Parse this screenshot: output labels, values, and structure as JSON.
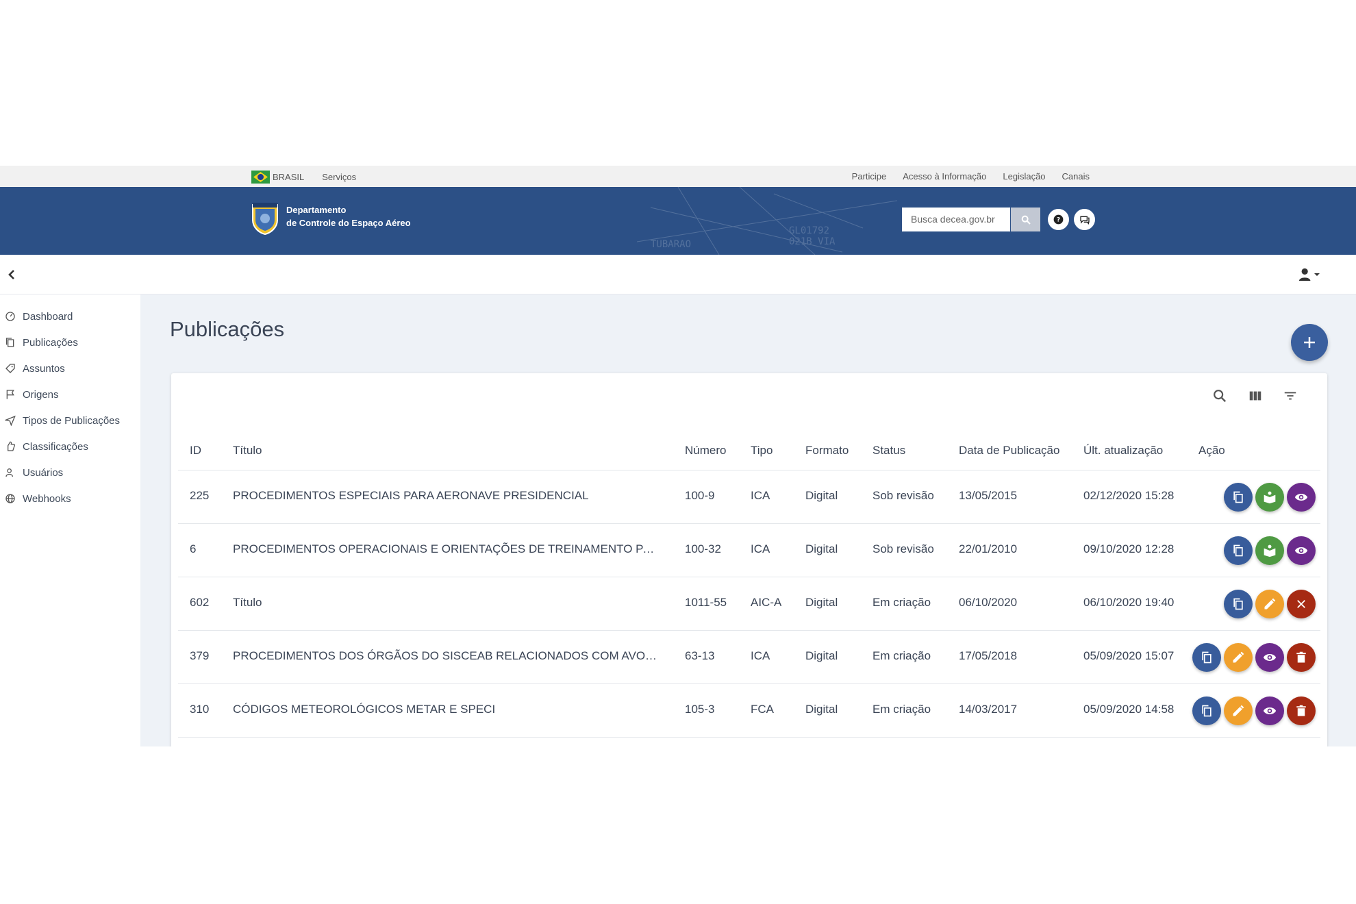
{
  "gov_bar": {
    "country": "BRASIL",
    "services": "Serviços",
    "links": [
      "Participe",
      "Acesso à Informação",
      "Legislação",
      "Canais"
    ]
  },
  "decea": {
    "brand_line1": "Departamento",
    "brand_line2": "de Controle do Espaço Aéreo",
    "search_placeholder": "Busca decea.gov.br"
  },
  "sidebar": {
    "items": [
      {
        "label": "Dashboard",
        "icon": "dashboard-icon"
      },
      {
        "label": "Publicações",
        "icon": "copy-icon"
      },
      {
        "label": "Assuntos",
        "icon": "tag-icon"
      },
      {
        "label": "Origens",
        "icon": "flag-icon"
      },
      {
        "label": "Tipos de Publicações",
        "icon": "send-icon"
      },
      {
        "label": "Classificações",
        "icon": "thumb-icon"
      },
      {
        "label": "Usuários",
        "icon": "users-icon"
      },
      {
        "label": "Webhooks",
        "icon": "globe-icon"
      }
    ]
  },
  "main": {
    "title": "Publicações"
  },
  "table": {
    "headers": [
      "ID",
      "Título",
      "Número",
      "Tipo",
      "Formato",
      "Status",
      "Data de Publicação",
      "Últ. atualização",
      "Ação"
    ],
    "rows": [
      {
        "id": "225",
        "titulo": "PROCEDIMENTOS ESPECIAIS PARA AERONAVE PRESIDENCIAL",
        "numero": "100-9",
        "tipo": "ICA",
        "formato": "Digital",
        "status": "Sob revisão",
        "data": "13/05/2015",
        "atualizacao": "02/12/2020 15:28",
        "actions": [
          "copy",
          "publish",
          "view"
        ]
      },
      {
        "id": "6",
        "titulo": "PROCEDIMENTOS OPERACIONAIS E ORIENTAÇÕES DE TREINAMENTO PARA CONTROLADORES DE TRÁFEGO AÉREO",
        "numero": "100-32",
        "tipo": "ICA",
        "formato": "Digital",
        "status": "Sob revisão",
        "data": "22/01/2010",
        "atualizacao": "09/10/2020 12:28",
        "actions": [
          "copy",
          "publish",
          "view"
        ]
      },
      {
        "id": "602",
        "titulo": "Título",
        "numero": "1011-55",
        "tipo": "AIC-A",
        "formato": "Digital",
        "status": "Em criação",
        "data": "06/10/2020",
        "atualizacao": "06/10/2020 19:40",
        "actions": [
          "copy",
          "edit",
          "cancel"
        ]
      },
      {
        "id": "379",
        "titulo": "PROCEDIMENTOS DOS ÓRGÃOS DO SISCEAB RELACIONADOS COM AVOES PRESIDENCIAIS",
        "numero": "63-13",
        "tipo": "ICA",
        "formato": "Digital",
        "status": "Em criação",
        "data": "17/05/2018",
        "atualizacao": "05/09/2020 15:07",
        "actions": [
          "copy",
          "edit",
          "view",
          "delete"
        ]
      },
      {
        "id": "310",
        "titulo": "CÓDIGOS METEOROLÓGICOS METAR E SPECI",
        "numero": "105-3",
        "tipo": "FCA",
        "formato": "Digital",
        "status": "Em criação",
        "data": "14/03/2017",
        "atualizacao": "05/09/2020 14:58",
        "actions": [
          "copy",
          "edit",
          "view",
          "delete"
        ]
      }
    ]
  },
  "colors": {
    "header_blue": "#2c5086",
    "copy": "#385c9b",
    "publish": "#4f9a43",
    "view": "#6b2a8c",
    "edit": "#f0a02c",
    "delete": "#a62a13"
  }
}
